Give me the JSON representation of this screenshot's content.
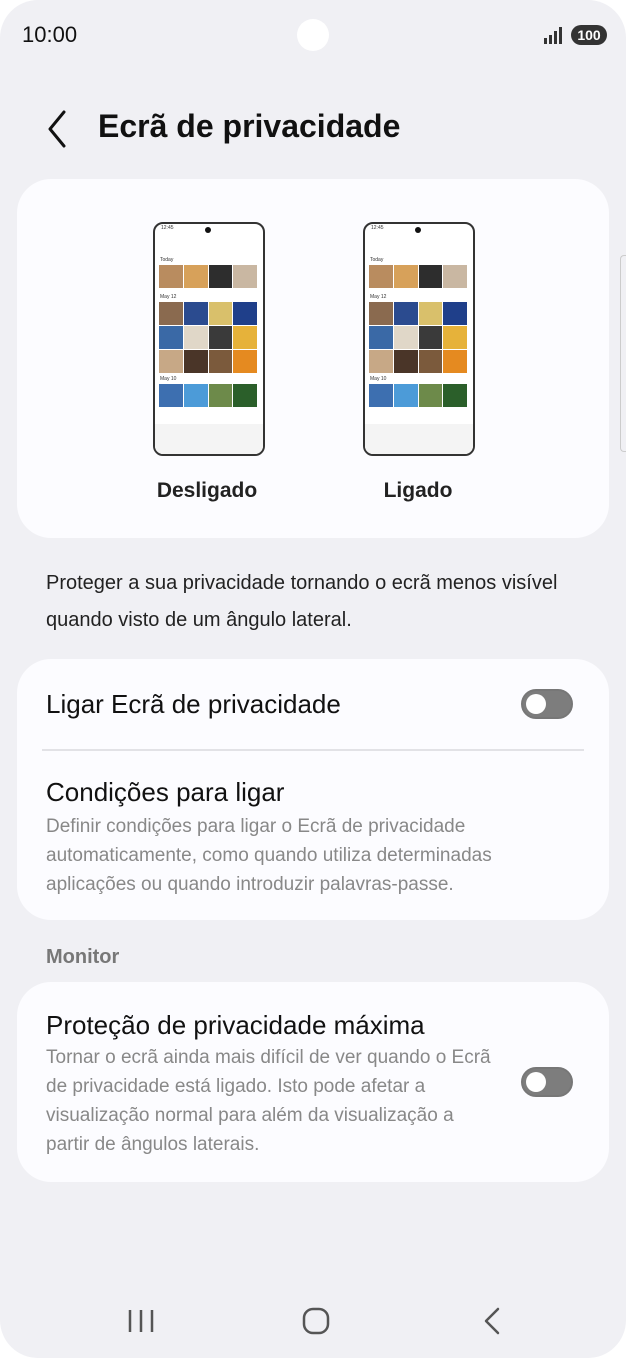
{
  "status": {
    "time": "10:00",
    "battery": "100"
  },
  "header": {
    "title": "Ecrã de privacidade"
  },
  "preview": {
    "off_label": "Desligado",
    "on_label": "Ligado",
    "mini_time": "12:45",
    "mini_today": "Today",
    "mini_may12": "May 12",
    "mini_may10": "May 10"
  },
  "description": "Proteger a sua privacidade tornando o ecrã menos visível quando visto de um ângulo lateral.",
  "settings": {
    "toggle_title": "Ligar Ecrã de privacidade",
    "toggle_on": false,
    "conditions_title": "Condições para ligar",
    "conditions_sub": "Definir condições para ligar o Ecrã de privacidade automaticamente, como quando utiliza determinadas aplicações ou quando introduzir palavras-passe."
  },
  "monitor": {
    "section": "Monitor",
    "title": "Proteção de privacidade máxima",
    "sub": "Tornar o ecrã ainda mais difícil de ver quando o Ecrã de privacidade está ligado. Isto pode afetar a visualização normal para além da visualização a partir de ângulos laterais.",
    "toggle_on": false
  },
  "icons": {
    "back": "chevron-left-icon",
    "signal": "signal-icon",
    "recents": "recents-icon",
    "home": "home-icon",
    "nav_back": "back-icon"
  },
  "colors": {
    "background": "#f0f0f4",
    "card": "#fcfcff",
    "toggle_off": "#7d7d7d"
  }
}
